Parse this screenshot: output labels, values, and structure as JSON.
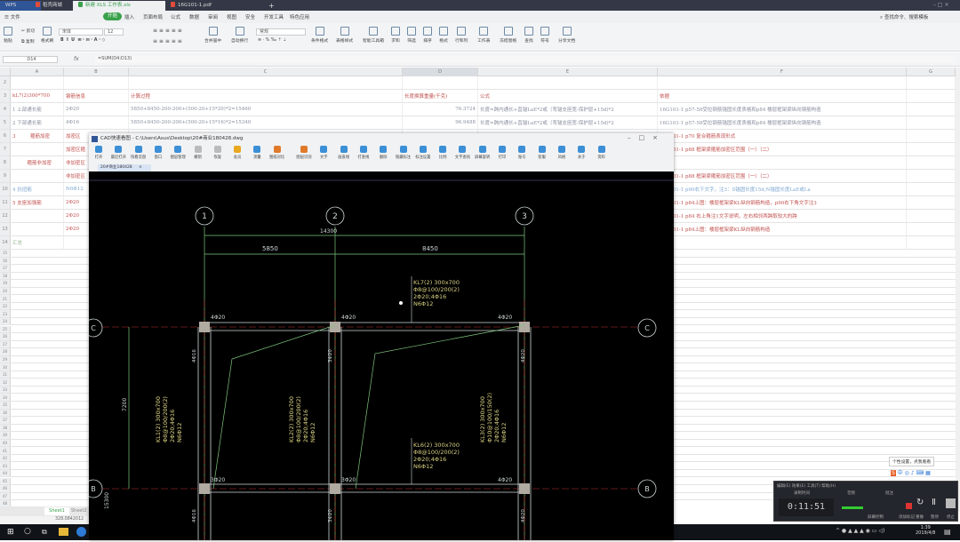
{
  "titlebar": {
    "tabs": [
      {
        "label": "WPS",
        "color": "#2f5597"
      },
      {
        "label": "稻壳商城",
        "color": "#e04b3a"
      },
      {
        "label": "新建 XLS 工作表.xls",
        "color": "#3aa14b"
      },
      {
        "label": "16G101-1.pdf",
        "color": "#e04b3a"
      }
    ],
    "new_tab": "+"
  },
  "menubar": {
    "file": "文件",
    "items": [
      "开始",
      "插入",
      "页面布局",
      "公式",
      "数据",
      "审阅",
      "视图",
      "安全",
      "开发工具",
      "特色应用"
    ],
    "active": "开始",
    "search": "查找命令、搜索模板"
  },
  "ribbon": {
    "paste": "粘贴",
    "cut": "剪切",
    "copy": "复制",
    "format_painter": "格式刷",
    "font": "宋体",
    "size": "12",
    "merge": "合并居中",
    "wrap": "自动换行",
    "number_format": "常规",
    "buttons": [
      "条件格式",
      "表格样式",
      "智能工具箱",
      "求和",
      "筛选",
      "排序",
      "格式",
      "行和列",
      "工作表",
      "冻结窗格",
      "查找",
      "符号",
      "分享文档"
    ]
  },
  "formula_bar": {
    "cell_ref": "D14",
    "fx": "fx",
    "formula": "=SUM(D4:D13)"
  },
  "columns": [
    "A",
    "B",
    "C",
    "D",
    "E",
    "F",
    "G"
  ],
  "rows": [
    {
      "n": "2",
      "cells": [
        "",
        "",
        "",
        "",
        "",
        ""
      ]
    },
    {
      "n": "3",
      "cells": [
        "kL7(2)300*700",
        "钢筋信息",
        "计算过程",
        "长度换算重量(千克)",
        "公式",
        "依据"
      ]
    },
    {
      "n": "4",
      "cells": [
        "1 上部通长筋",
        "2Φ20",
        "5850+8450-200-200+(500-20+15*20)*2=15460",
        "76.3724",
        "长度=跨内通长+直锚LaE*2或（弯锚支座宽-保护层+15d)*2",
        "16G101-1  p57-58受拉钢筋锚固长度表格和p84 楼层框架梁纵向钢筋构造"
      ]
    },
    {
      "n": "5",
      "cells": [
        "2 下部通长筋",
        "4Φ16",
        "5850+8450-200-200+(500-20+15*16)*2=15340",
        "96.9488",
        "长度=跨内通长+直锚LaE*2或（弯锚支座宽-保护层+15d)*2",
        "16G101-1  p57-58受拉钢筋锚固长度表格和p84 楼层框架梁纵向钢筋构造"
      ]
    },
    {
      "n": "6",
      "cells": [
        "3　　　箍筋加密",
        "加密区",
        "",
        "",
        "",
        "16G101-1  p70 复合箍筋表现形式"
      ]
    },
    {
      "n": "7",
      "cells": [
        "",
        "加密区箍",
        "",
        "",
        "",
        "16G101-1  p88 框架梁箍筋加密区范围（一）（二）"
      ]
    },
    {
      "n": "8",
      "cells": [
        "　　　箍筋非加密",
        "非加密区",
        "",
        "",
        "",
        ""
      ]
    },
    {
      "n": "9",
      "cells": [
        "",
        "非加密区",
        "",
        "",
        "",
        "16G101-1  p88 框架梁箍筋加密区范围（一）（二）"
      ]
    },
    {
      "n": "10",
      "cells": [
        "4 抗扭筋",
        "N6Φ12",
        "",
        "",
        "",
        "16G101-1  p90右下文字，注3：S锚固长度15d,N锚固长度LaE或La"
      ]
    },
    {
      "n": "11",
      "cells": [
        "5 支座加强筋",
        "2Φ20",
        "",
        "",
        "",
        "16G101-1  p84上图：楼层框架梁KL纵向钢筋构造，p90右下角文字注3"
      ]
    },
    {
      "n": "12",
      "cells": [
        "",
        "2Φ20",
        "",
        "",
        "",
        "16G101-1  p84 右上角注1文字说明，左右相邻两跨取较大的跨"
      ]
    },
    {
      "n": "13",
      "cells": [
        "",
        "2Φ20",
        "",
        "",
        "",
        "16G101-1  p84上图：楼层框架梁KL纵向钢筋构造"
      ]
    },
    {
      "n": "14",
      "cells": [
        "汇总",
        "",
        "",
        "",
        "",
        ""
      ]
    }
  ],
  "empty_rows": [
    "15",
    "16",
    "17",
    "18",
    "19",
    "20",
    "21",
    "22",
    "23",
    "24",
    "25",
    "26",
    "27",
    "28",
    "29",
    "30",
    "31",
    "32",
    "33",
    "34",
    "35",
    "36",
    "37",
    "38",
    "39",
    "40",
    "41",
    "42",
    "43",
    "44",
    "45",
    "46",
    "47",
    "48"
  ],
  "sheets": [
    "Sheet1",
    "Sheet2"
  ],
  "status": "328.0842012",
  "cad": {
    "title": "CAD快速看图 - C:\\Users\\Asus\\Desktop\\20#商业180428.dwg",
    "tab": "20#商业180428",
    "tab_close": "×",
    "toolbar": [
      "打开",
      "最近打开",
      "快看云盘",
      "窗口",
      "图层管理",
      "撤销",
      "恢复",
      "会员",
      "测量",
      "图纸对比",
      "图层识别",
      "文字",
      "画直线",
      "打查线",
      "删除",
      "隐藏标注",
      "标注设置",
      "比例",
      "文字查找",
      "屏幕旋转",
      "打印",
      "账号",
      "客服",
      "风格",
      "关于",
      "资料"
    ],
    "drawing": {
      "axes": [
        "1",
        "2",
        "3",
        "C",
        "B"
      ],
      "dims": [
        "14300",
        "5850",
        "8450",
        "7200",
        "15300"
      ],
      "beam_top": [
        "4Φ20",
        "4Φ20",
        "4Φ20"
      ],
      "beam_bottom": [
        "3Φ20",
        "3Φ20",
        "4Φ20"
      ],
      "col_side": [
        "4Φ16",
        "3Φ20",
        "4Φ20",
        "4Φ16",
        "3Φ20",
        "4Φ20"
      ],
      "kl7": [
        "KL7(2) 300x700",
        "Φ8@100/200(2)",
        "2Φ20;4Φ16",
        "N6Φ12"
      ],
      "kl6": [
        "KL6(2) 300x700",
        "Φ8@100/200(2)",
        "2Φ20;4Φ16",
        "N6Φ12"
      ],
      "kl1": [
        "KL1(2) 300x700",
        "Φ8@100/200(2)",
        "2Φ20;4Φ16",
        "N6Φ12"
      ],
      "kl2": [
        "KL2(2) 300x700",
        "Φ8@100/200(2)",
        "2Φ20;4Φ16",
        "N6Φ12"
      ],
      "kl3": [
        "KL3(2) 300x700",
        "Φ10@100/150(2)",
        "2Φ20;4Φ16",
        "N6Φ12"
      ]
    }
  },
  "recorder": {
    "menu": [
      "编辑(E)",
      "效果(E)",
      "工具(T)",
      "帮助(H)"
    ],
    "time_label": "录制时间",
    "time": "0:11:51",
    "audio": "音频",
    "annot": "批注",
    "screen_ctrl": "屏幕控制",
    "add_mark": "添加标记",
    "redo": "重做",
    "pause": "暂停",
    "stop": "停止"
  },
  "tooltip": "个性设置，点我看看",
  "clock": {
    "time": "1:39",
    "date": "2019/4/8"
  }
}
